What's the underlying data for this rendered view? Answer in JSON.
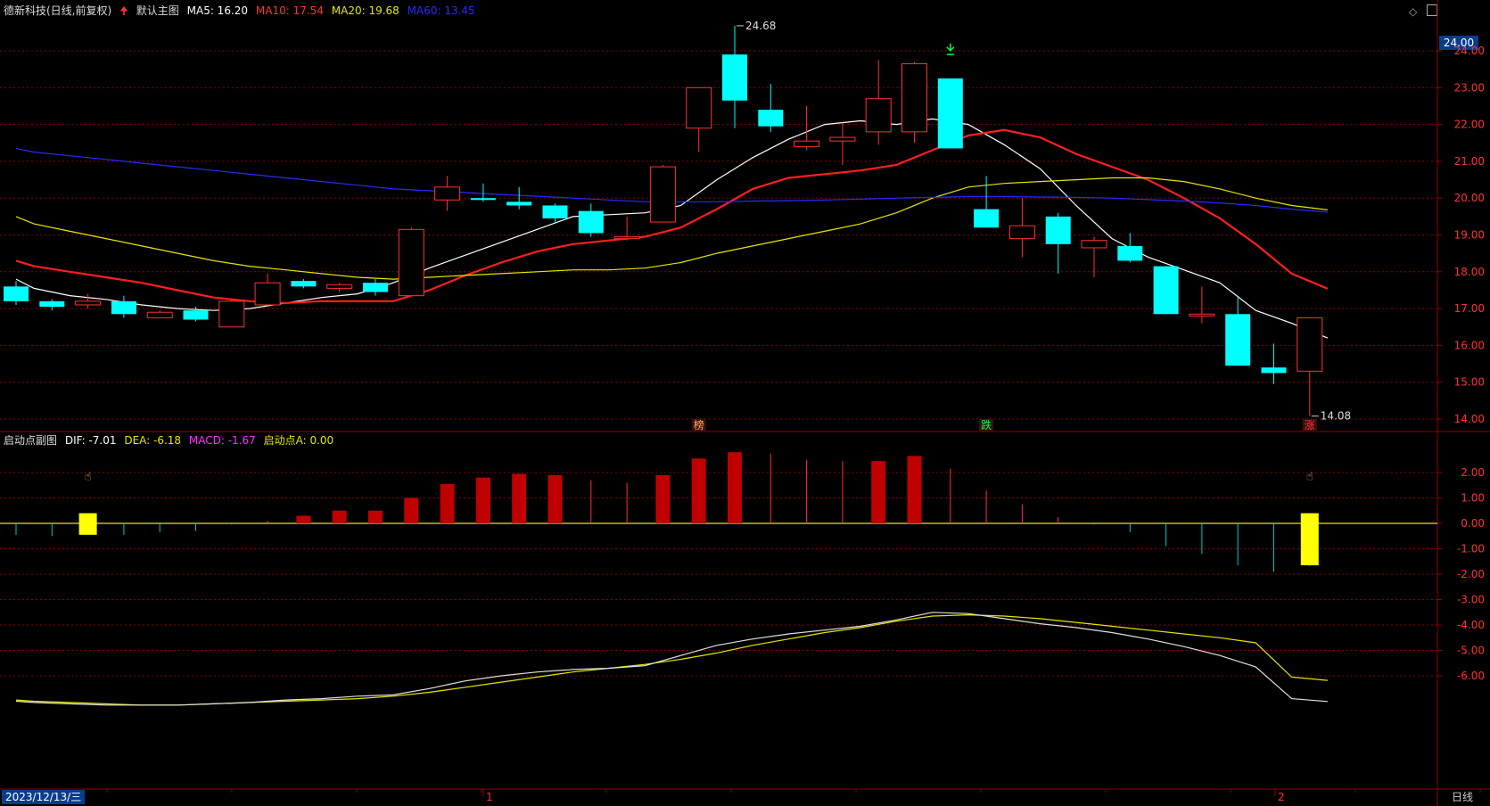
{
  "header": {
    "stock": "德新科技(日线,前复权)",
    "main_chart_name": "默认主图",
    "ma5": "MA5: 16.20",
    "ma10": "MA10: 17.54",
    "ma20": "MA20: 19.68",
    "ma60": "MA60: 13.45"
  },
  "sub_header": {
    "name": "启动点副图",
    "dif": "DIF: -7.01",
    "dea": "DEA: -6.18",
    "macd": "MACD: -1.67",
    "point_a": "启动点A: 0.00"
  },
  "colors": {
    "up": "#ff3232",
    "down": "#00ffff",
    "ma5": "#ffffff",
    "ma10": "#ff1e1e",
    "ma20": "#e6e600",
    "ma60": "#2a2aff",
    "grid": "#8c0000",
    "bg": "#000000",
    "marker": "#ffff00"
  },
  "footer": {
    "date": "2023/12/13/三",
    "period": "日线",
    "tick_1": "1",
    "tick_2": "2"
  },
  "price_tag": "24.00",
  "toolbar_icons": [
    "diamond-icon",
    "maximize-icon"
  ],
  "chart_data": [
    {
      "type": "candlestick",
      "title": "",
      "ylim": [
        13.8,
        24.8
      ],
      "yticks": [
        "24.00",
        "23.00",
        "22.00",
        "21.00",
        "20.00",
        "19.00",
        "18.00",
        "17.00",
        "16.00",
        "15.00",
        "14.00"
      ],
      "candles": [
        {
          "o": 17.6,
          "h": 17.75,
          "l": 17.1,
          "c": 17.2
        },
        {
          "o": 17.2,
          "h": 17.25,
          "l": 16.95,
          "c": 17.05
        },
        {
          "o": 17.1,
          "h": 17.4,
          "l": 17.0,
          "c": 17.2
        },
        {
          "o": 17.2,
          "h": 17.35,
          "l": 16.75,
          "c": 16.85
        },
        {
          "o": 16.75,
          "h": 16.95,
          "l": 16.75,
          "c": 16.9
        },
        {
          "o": 16.95,
          "h": 17.05,
          "l": 16.65,
          "c": 16.7
        },
        {
          "o": 16.5,
          "h": 17.25,
          "l": 16.5,
          "c": 17.2
        },
        {
          "o": 17.1,
          "h": 17.95,
          "l": 17.05,
          "c": 17.7
        },
        {
          "o": 17.75,
          "h": 17.8,
          "l": 17.55,
          "c": 17.6
        },
        {
          "o": 17.55,
          "h": 17.7,
          "l": 17.45,
          "c": 17.65
        },
        {
          "o": 17.7,
          "h": 17.8,
          "l": 17.35,
          "c": 17.45
        },
        {
          "o": 17.35,
          "h": 19.2,
          "l": 17.35,
          "c": 19.15
        },
        {
          "o": 19.95,
          "h": 20.6,
          "l": 19.65,
          "c": 20.3
        },
        {
          "o": 20.0,
          "h": 20.4,
          "l": 19.9,
          "c": 19.95
        },
        {
          "o": 19.9,
          "h": 20.3,
          "l": 19.7,
          "c": 19.8
        },
        {
          "o": 19.8,
          "h": 19.85,
          "l": 19.3,
          "c": 19.45
        },
        {
          "o": 19.65,
          "h": 19.85,
          "l": 18.95,
          "c": 19.05
        },
        {
          "o": 18.9,
          "h": 19.5,
          "l": 18.85,
          "c": 18.95
        },
        {
          "o": 19.35,
          "h": 20.9,
          "l": 19.35,
          "c": 20.85
        },
        {
          "o": 21.9,
          "h": 23.0,
          "l": 21.25,
          "c": 23.0
        },
        {
          "o": 23.9,
          "h": 24.68,
          "l": 21.9,
          "c": 22.65
        },
        {
          "o": 22.4,
          "h": 23.1,
          "l": 21.8,
          "c": 21.95
        },
        {
          "o": 21.4,
          "h": 22.5,
          "l": 21.3,
          "c": 21.55
        },
        {
          "o": 21.55,
          "h": 22.05,
          "l": 20.9,
          "c": 21.65
        },
        {
          "o": 21.8,
          "h": 23.75,
          "l": 21.45,
          "c": 22.7
        },
        {
          "o": 21.8,
          "h": 23.7,
          "l": 21.5,
          "c": 23.65
        },
        {
          "o": 23.25,
          "h": 23.25,
          "l": 21.35,
          "c": 21.35
        },
        {
          "o": 19.7,
          "h": 20.6,
          "l": 19.2,
          "c": 19.2
        },
        {
          "o": 18.9,
          "h": 20.0,
          "l": 18.4,
          "c": 19.25
        },
        {
          "o": 19.5,
          "h": 19.6,
          "l": 17.95,
          "c": 18.75
        },
        {
          "o": 18.65,
          "h": 18.95,
          "l": 17.85,
          "c": 18.85
        },
        {
          "o": 18.7,
          "h": 19.05,
          "l": 18.25,
          "c": 18.3
        },
        {
          "o": 18.15,
          "h": 18.15,
          "l": 16.85,
          "c": 16.85
        },
        {
          "o": 16.8,
          "h": 17.6,
          "l": 16.6,
          "c": 16.85
        },
        {
          "o": 16.85,
          "h": 17.3,
          "l": 15.45,
          "c": 15.45
        },
        {
          "o": 15.4,
          "h": 16.05,
          "l": 14.95,
          "c": 15.25
        },
        {
          "o": 15.3,
          "h": 16.75,
          "l": 14.08,
          "c": 16.75
        }
      ],
      "series": [
        {
          "name": "MA5",
          "values": [
            17.8,
            17.55,
            17.35,
            17.25,
            17.1,
            17.0,
            16.95,
            17.0,
            17.15,
            17.3,
            17.4,
            17.7,
            18.1,
            18.45,
            18.8,
            19.15,
            19.5,
            19.55,
            19.6,
            19.8,
            20.5,
            21.1,
            21.6,
            22.0,
            22.1,
            22.0,
            22.15,
            22.0,
            21.45,
            20.8,
            19.8,
            18.9,
            18.4,
            18.05,
            17.7,
            16.95,
            16.6,
            16.2
          ]
        },
        {
          "name": "MA10",
          "values": [
            18.3,
            18.15,
            18.0,
            17.85,
            17.7,
            17.5,
            17.3,
            17.2,
            17.15,
            17.2,
            17.2,
            17.2,
            17.5,
            17.9,
            18.25,
            18.55,
            18.75,
            18.85,
            18.95,
            19.2,
            19.7,
            20.25,
            20.55,
            20.65,
            20.75,
            20.9,
            21.3,
            21.7,
            21.85,
            21.65,
            21.2,
            20.85,
            20.5,
            20.0,
            19.45,
            18.75,
            17.95,
            17.54
          ]
        },
        {
          "name": "MA20",
          "values": [
            19.5,
            19.3,
            19.1,
            18.9,
            18.7,
            18.5,
            18.3,
            18.15,
            18.05,
            17.95,
            17.85,
            17.8,
            17.85,
            17.9,
            17.95,
            18.0,
            18.05,
            18.05,
            18.1,
            18.25,
            18.5,
            18.7,
            18.9,
            19.1,
            19.3,
            19.6,
            20.0,
            20.3,
            20.4,
            20.45,
            20.5,
            20.55,
            20.55,
            20.45,
            20.25,
            20.0,
            19.8,
            19.68
          ]
        },
        {
          "name": "MA60",
          "values": [
            21.35,
            21.25,
            21.15,
            21.05,
            20.95,
            20.85,
            20.75,
            20.65,
            20.55,
            20.45,
            20.35,
            20.25,
            20.2,
            20.15,
            20.1,
            20.05,
            20.0,
            19.95,
            19.9,
            19.9,
            19.9,
            19.92,
            19.93,
            19.95,
            19.97,
            20.0,
            20.02,
            20.04,
            20.04,
            20.03,
            20.02,
            20.0,
            19.96,
            19.92,
            19.87,
            19.8,
            19.7,
            19.62
          ]
        }
      ],
      "annotations": [
        {
          "text": "24.68",
          "index": 20,
          "value": 24.68
        },
        {
          "text": "14.08",
          "index": 36,
          "value": 14.08
        },
        {
          "text": "榜",
          "index": 19
        },
        {
          "text": "跌",
          "index": 27
        },
        {
          "text": "涨",
          "index": 36
        }
      ]
    },
    {
      "type": "macd",
      "title": "",
      "ylim": [
        -8.0,
        3.3
      ],
      "yticks": [
        "2.00",
        "1.00",
        "0.00",
        "-1.00",
        "-2.00",
        "-3.00",
        "-4.00",
        "-5.00",
        "-6.00"
      ],
      "macd": [
        -0.45,
        -0.5,
        -0.25,
        -0.45,
        -0.35,
        -0.3,
        -0.05,
        0.1,
        0.3,
        0.5,
        0.5,
        1.0,
        1.55,
        1.8,
        1.95,
        1.9,
        1.7,
        1.6,
        1.9,
        2.55,
        2.8,
        2.75,
        2.5,
        2.45,
        2.45,
        2.65,
        2.15,
        1.3,
        0.75,
        0.25,
        -0.05,
        -0.35,
        -0.9,
        -1.2,
        -1.65,
        -1.9,
        -1.67
      ],
      "dif": [
        -7.0,
        -7.05,
        -7.1,
        -7.15,
        -7.15,
        -7.15,
        -7.1,
        -7.05,
        -6.95,
        -6.9,
        -6.8,
        -6.75,
        -6.5,
        -6.2,
        -6.0,
        -5.85,
        -5.75,
        -5.7,
        -5.6,
        -5.2,
        -4.8,
        -4.55,
        -4.35,
        -4.2,
        -4.05,
        -3.8,
        -3.5,
        -3.55,
        -3.75,
        -3.95,
        -4.1,
        -4.3,
        -4.55,
        -4.85,
        -5.2,
        -5.65,
        -6.9,
        -7.01
      ],
      "dea": [
        -6.95,
        -7.0,
        -7.05,
        -7.1,
        -7.15,
        -7.15,
        -7.1,
        -7.05,
        -7.0,
        -6.95,
        -6.9,
        -6.8,
        -6.65,
        -6.45,
        -6.25,
        -6.05,
        -5.85,
        -5.7,
        -5.55,
        -5.35,
        -5.1,
        -4.8,
        -4.55,
        -4.3,
        -4.1,
        -3.85,
        -3.65,
        -3.6,
        -3.65,
        -3.75,
        -3.9,
        -4.05,
        -4.2,
        -4.35,
        -4.5,
        -4.7,
        -6.05,
        -6.18
      ],
      "start_points": [
        2,
        36
      ]
    }
  ]
}
